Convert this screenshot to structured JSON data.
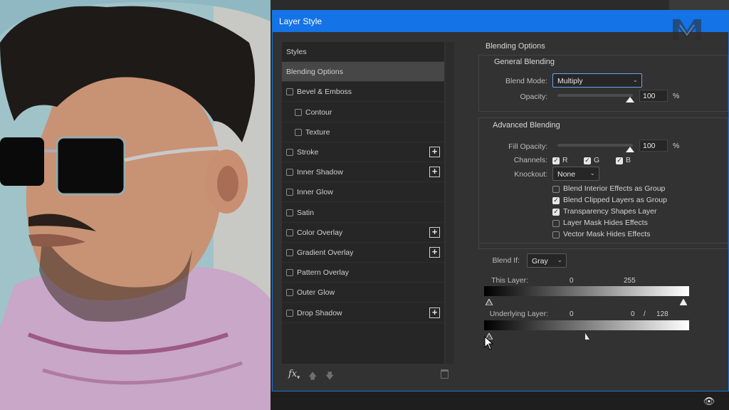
{
  "dialog": {
    "title": "Layer Style"
  },
  "styles_list": {
    "items": [
      {
        "label": "Styles",
        "checkbox": false,
        "plus": false,
        "indent": false,
        "selected": false
      },
      {
        "label": "Blending Options",
        "checkbox": false,
        "plus": false,
        "indent": false,
        "selected": true
      },
      {
        "label": "Bevel & Emboss",
        "checkbox": true,
        "plus": false,
        "indent": false,
        "selected": false
      },
      {
        "label": "Contour",
        "checkbox": true,
        "plus": false,
        "indent": true,
        "selected": false
      },
      {
        "label": "Texture",
        "checkbox": true,
        "plus": false,
        "indent": true,
        "selected": false
      },
      {
        "label": "Stroke",
        "checkbox": true,
        "plus": true,
        "indent": false,
        "selected": false
      },
      {
        "label": "Inner Shadow",
        "checkbox": true,
        "plus": true,
        "indent": false,
        "selected": false
      },
      {
        "label": "Inner Glow",
        "checkbox": true,
        "plus": false,
        "indent": false,
        "selected": false
      },
      {
        "label": "Satin",
        "checkbox": true,
        "plus": false,
        "indent": false,
        "selected": false
      },
      {
        "label": "Color Overlay",
        "checkbox": true,
        "plus": true,
        "indent": false,
        "selected": false
      },
      {
        "label": "Gradient Overlay",
        "checkbox": true,
        "plus": true,
        "indent": false,
        "selected": false
      },
      {
        "label": "Pattern Overlay",
        "checkbox": true,
        "plus": false,
        "indent": false,
        "selected": false
      },
      {
        "label": "Outer Glow",
        "checkbox": true,
        "plus": false,
        "indent": false,
        "selected": false
      },
      {
        "label": "Drop Shadow",
        "checkbox": true,
        "plus": true,
        "indent": false,
        "selected": false
      }
    ],
    "footer": {
      "fx": "fx"
    }
  },
  "blending": {
    "title": "Blending Options",
    "general": {
      "title": "General Blending",
      "blend_mode_label": "Blend Mode:",
      "blend_mode_value": "Multiply",
      "opacity_label": "Opacity:",
      "opacity_value": "100",
      "opacity_unit": "%"
    },
    "advanced": {
      "title": "Advanced Blending",
      "fill_label": "Fill Opacity:",
      "fill_value": "100",
      "fill_unit": "%",
      "channels_label": "Channels:",
      "channels": [
        {
          "label": "R",
          "checked": true
        },
        {
          "label": "G",
          "checked": true
        },
        {
          "label": "B",
          "checked": true
        }
      ],
      "knockout_label": "Knockout:",
      "knockout_value": "None",
      "options": [
        {
          "label": "Blend Interior Effects as Group",
          "checked": false
        },
        {
          "label": "Blend Clipped Layers as Group",
          "checked": true
        },
        {
          "label": "Transparency Shapes Layer",
          "checked": true
        },
        {
          "label": "Layer Mask Hides Effects",
          "checked": false
        },
        {
          "label": "Vector Mask Hides Effects",
          "checked": false
        }
      ]
    },
    "blend_if": {
      "label": "Blend If:",
      "value": "Gray",
      "this_layer_label": "This Layer:",
      "this_layer_low": "0",
      "this_layer_high": "255",
      "underlying_label": "Underlying Layer:",
      "underlying_low": "0",
      "underlying_mid": "0",
      "underlying_sep": "/",
      "underlying_high": "128"
    }
  }
}
